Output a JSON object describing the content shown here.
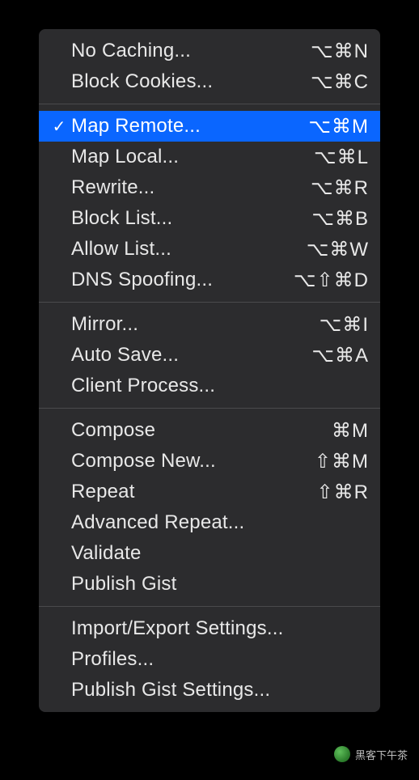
{
  "groups": [
    {
      "items": [
        {
          "id": "no-caching",
          "label": "No Caching...",
          "shortcut": "⌥⌘N",
          "checked": false
        },
        {
          "id": "block-cookies",
          "label": "Block Cookies...",
          "shortcut": "⌥⌘C",
          "checked": false
        }
      ]
    },
    {
      "items": [
        {
          "id": "map-remote",
          "label": "Map Remote...",
          "shortcut": "⌥⌘M",
          "checked": true,
          "selected": true
        },
        {
          "id": "map-local",
          "label": "Map Local...",
          "shortcut": "⌥⌘L",
          "checked": false
        },
        {
          "id": "rewrite",
          "label": "Rewrite...",
          "shortcut": "⌥⌘R",
          "checked": false
        },
        {
          "id": "block-list",
          "label": "Block List...",
          "shortcut": "⌥⌘B",
          "checked": false
        },
        {
          "id": "allow-list",
          "label": "Allow List...",
          "shortcut": "⌥⌘W",
          "checked": false
        },
        {
          "id": "dns-spoofing",
          "label": "DNS Spoofing...",
          "shortcut": "⌥⇧⌘D",
          "checked": false
        }
      ]
    },
    {
      "items": [
        {
          "id": "mirror",
          "label": "Mirror...",
          "shortcut": "⌥⌘I",
          "checked": false
        },
        {
          "id": "auto-save",
          "label": "Auto Save...",
          "shortcut": "⌥⌘A",
          "checked": false
        },
        {
          "id": "client-process",
          "label": "Client Process...",
          "shortcut": "",
          "checked": false
        }
      ]
    },
    {
      "items": [
        {
          "id": "compose",
          "label": "Compose",
          "shortcut": "⌘M",
          "checked": false
        },
        {
          "id": "compose-new",
          "label": "Compose New...",
          "shortcut": "⇧⌘M",
          "checked": false
        },
        {
          "id": "repeat",
          "label": "Repeat",
          "shortcut": "⇧⌘R",
          "checked": false
        },
        {
          "id": "advanced-repeat",
          "label": "Advanced Repeat...",
          "shortcut": "",
          "checked": false
        },
        {
          "id": "validate",
          "label": "Validate",
          "shortcut": "",
          "checked": false
        },
        {
          "id": "publish-gist",
          "label": "Publish Gist",
          "shortcut": "",
          "checked": false
        }
      ]
    },
    {
      "items": [
        {
          "id": "import-export-settings",
          "label": "Import/Export Settings...",
          "shortcut": "",
          "checked": false
        },
        {
          "id": "profiles",
          "label": "Profiles...",
          "shortcut": "",
          "checked": false
        },
        {
          "id": "publish-gist-settings",
          "label": "Publish Gist Settings...",
          "shortcut": "",
          "checked": false
        }
      ]
    }
  ],
  "checkmark_glyph": "✓",
  "watermark": {
    "text": "黑客下午茶"
  }
}
